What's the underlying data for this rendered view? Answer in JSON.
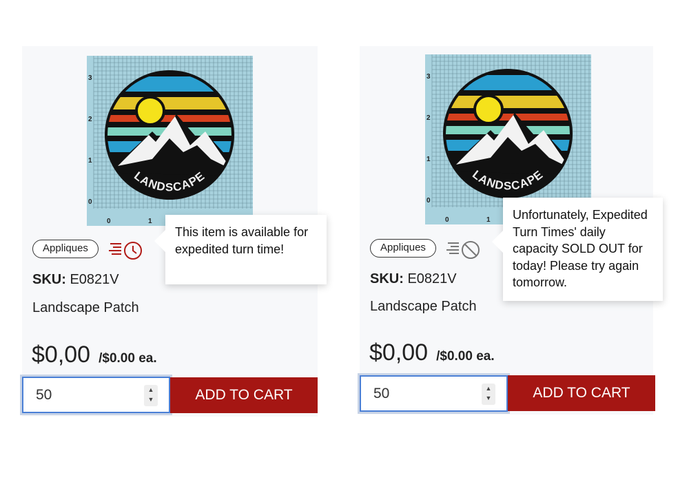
{
  "cards": [
    {
      "image_label": "LANDSCAPE",
      "ruler_labels": [
        "0",
        "1",
        "2",
        "3"
      ],
      "category": "Appliques",
      "expedite_icon": "expedited-clock-icon",
      "expedite_color": "#b11a16",
      "tooltip": "This item is available for expedited turn time!",
      "sku_label": "SKU:",
      "sku": "E0821V",
      "title": "Landscape Patch",
      "price": "$0,00",
      "unit_price": "/$0.00 ea.",
      "quantity": "50",
      "add_to_cart": "ADD TO CART"
    },
    {
      "image_label": "LANDSCAPE",
      "ruler_labels": [
        "0",
        "1",
        "2",
        "3"
      ],
      "category": "Appliques",
      "expedite_icon": "expedited-unavailable-icon",
      "expedite_color": "#777777",
      "tooltip": "Unfortunately, Expedited Turn Times' daily capacity SOLD OUT for today! Please try again tomorrow.",
      "sku_label": "SKU:",
      "sku": "E0821V",
      "title": "Landscape Patch",
      "price": "$0,00",
      "unit_price": "/$0.00 ea.",
      "quantity": "50",
      "add_to_cart": "ADD TO CART"
    }
  ],
  "colors": {
    "button": "#a51613",
    "focus": "#4a7fd6"
  }
}
